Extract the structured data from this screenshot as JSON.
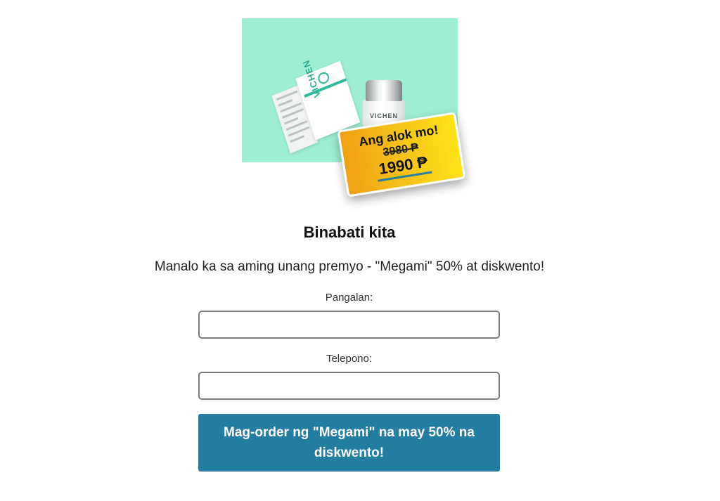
{
  "product": {
    "brand": "VICHEN",
    "jar_brand": "VICHEN"
  },
  "offer": {
    "title": "Ang alok mo!",
    "old_price": "3980 ₱",
    "new_price": "1990 ₱"
  },
  "heading": "Binabati kita",
  "message": "Manalo ka sa aming unang premyo - \"Megami\" 50% at diskwento!",
  "form": {
    "name_label": "Pangalan:",
    "name_value": "",
    "phone_label": "Telepono:",
    "phone_value": "",
    "submit_label": "Mag-order ng \"Megami\" na may 50% na diskwento!"
  },
  "colors": {
    "image_background": "#9eeed4",
    "badge_gradient_start": "#f0a014",
    "badge_gradient_end": "#ffe218",
    "button_background": "#247ea1"
  }
}
